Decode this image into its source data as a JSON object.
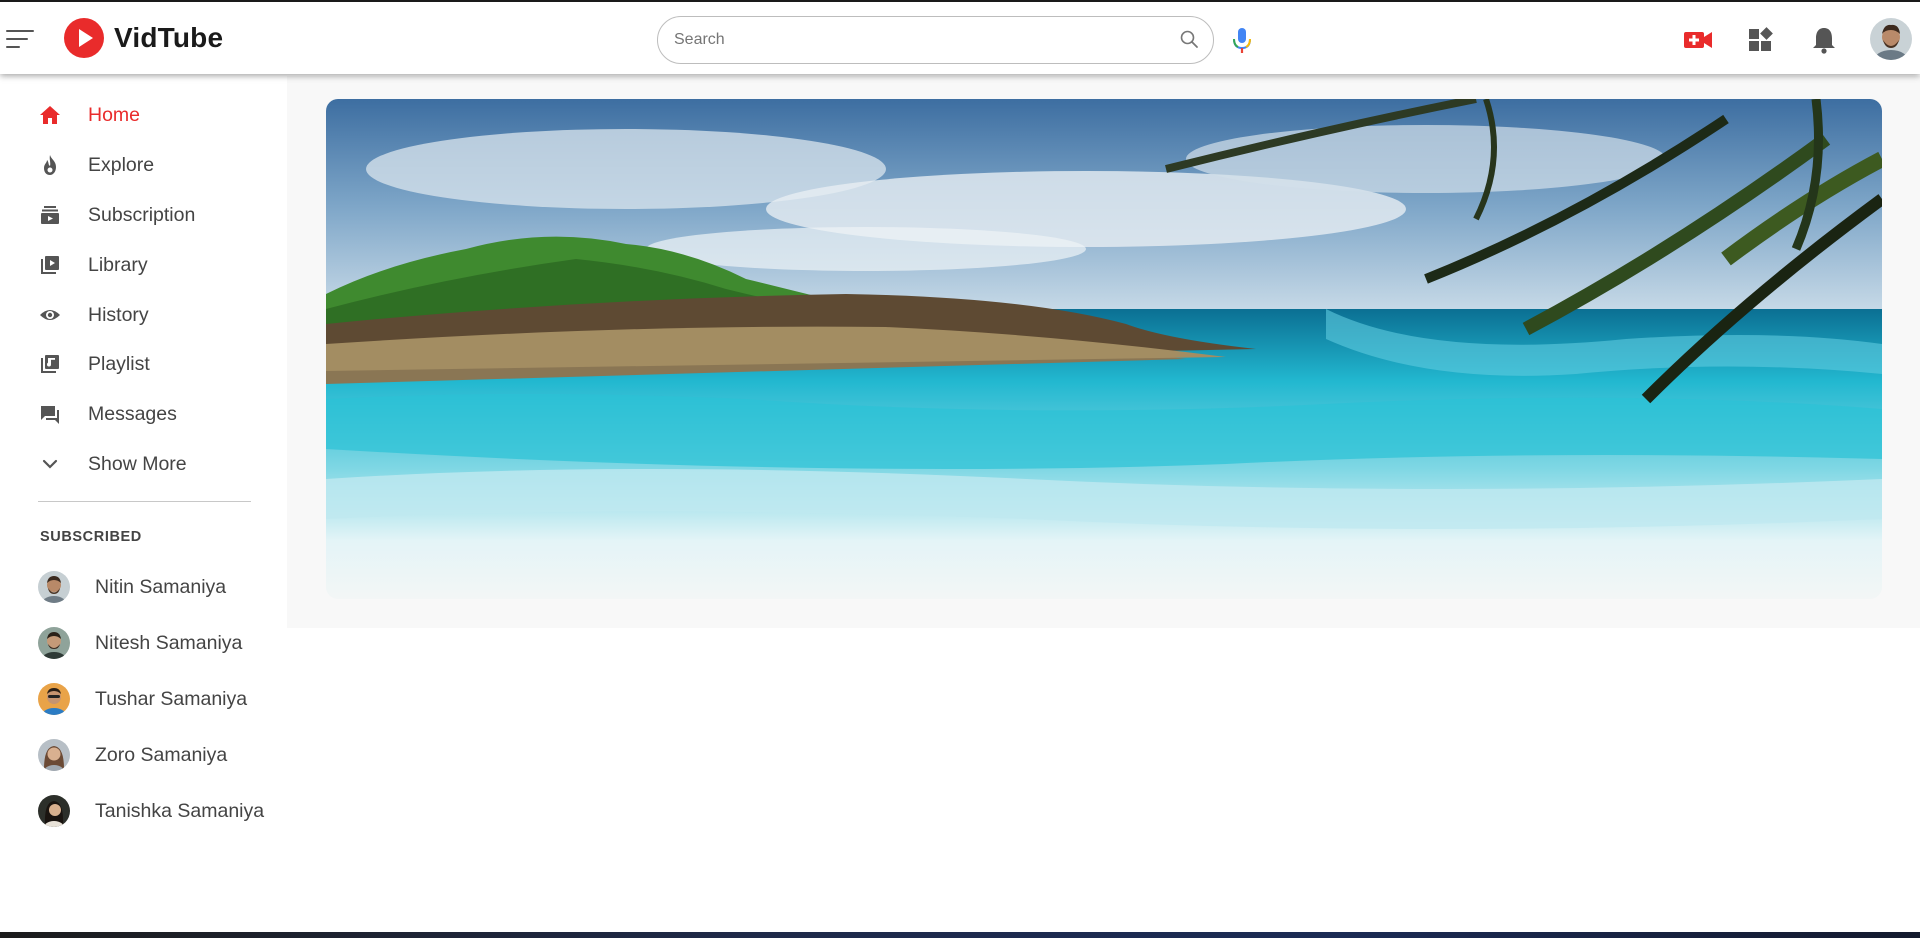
{
  "app": {
    "name": "VidTube"
  },
  "search": {
    "placeholder": "Search"
  },
  "sidebar": {
    "items": [
      {
        "label": "Home",
        "icon": "home-icon",
        "active": true
      },
      {
        "label": "Explore",
        "icon": "flame-icon"
      },
      {
        "label": "Subscription",
        "icon": "subscriptions-icon"
      },
      {
        "label": "Library",
        "icon": "library-icon"
      },
      {
        "label": "History",
        "icon": "eye-icon"
      },
      {
        "label": "Playlist",
        "icon": "playlist-icon"
      },
      {
        "label": "Messages",
        "icon": "chat-icon"
      },
      {
        "label": "Show More",
        "icon": "chevron-down-icon"
      }
    ],
    "subscribed_heading": "SUBSCRIBED",
    "subscriptions": [
      {
        "name": "Nitin Samaniya"
      },
      {
        "name": "Nitesh Samaniya"
      },
      {
        "name": "Tushar Samaniya"
      },
      {
        "name": "Zoro Samaniya"
      },
      {
        "name": "Tanishka Samaniya"
      }
    ]
  },
  "colors": {
    "accent": "#e92b2b",
    "text": "#444444",
    "icon": "#555555"
  }
}
